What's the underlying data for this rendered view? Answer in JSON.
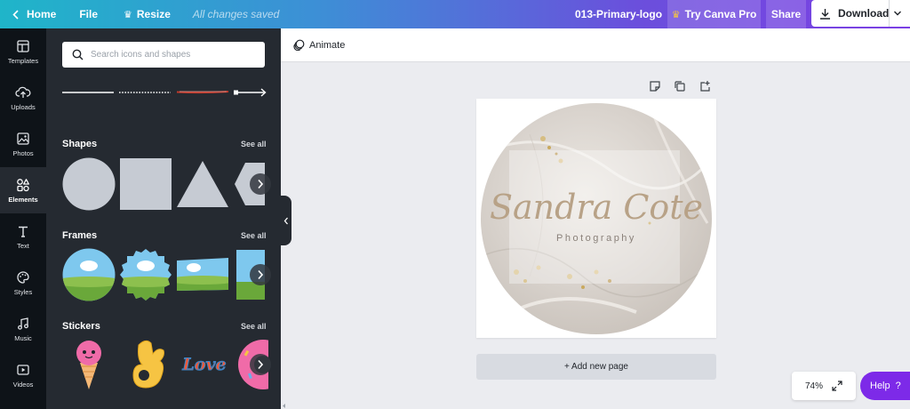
{
  "topbar": {
    "home_label": "Home",
    "file_label": "File",
    "resize_label": "Resize",
    "save_status": "All changes saved",
    "doc_name": "013-Primary-logo",
    "try_pro_label": "Try Canva Pro",
    "share_label": "Share",
    "download_label": "Download"
  },
  "rail": {
    "items": [
      {
        "label": "Templates",
        "icon": "templates-icon"
      },
      {
        "label": "Uploads",
        "icon": "upload-cloud-icon"
      },
      {
        "label": "Photos",
        "icon": "photo-icon"
      },
      {
        "label": "Elements",
        "icon": "elements-icon",
        "active": true
      },
      {
        "label": "Text",
        "icon": "text-icon"
      },
      {
        "label": "Styles",
        "icon": "palette-icon"
      },
      {
        "label": "Music",
        "icon": "music-note-icon"
      },
      {
        "label": "Videos",
        "icon": "video-icon"
      }
    ]
  },
  "panel": {
    "search_placeholder": "Search icons and shapes",
    "sections": [
      {
        "title": "Shapes",
        "see_all": "See all"
      },
      {
        "title": "Frames",
        "see_all": "See all"
      },
      {
        "title": "Stickers",
        "see_all": "See all"
      }
    ],
    "sticker_text": "Love"
  },
  "canvas": {
    "animate_label": "Animate",
    "logo_title": "Sandra Cote",
    "logo_subtitle": "Photography",
    "add_page_label": "+ Add new page",
    "zoom_label": "74%",
    "help_label": "Help",
    "help_icon": "?"
  },
  "colors": {
    "accent_purple": "#7d2ae8",
    "panel_bg": "#252a31",
    "rail_bg": "#0e1318",
    "logo_text": "#b8a287"
  }
}
